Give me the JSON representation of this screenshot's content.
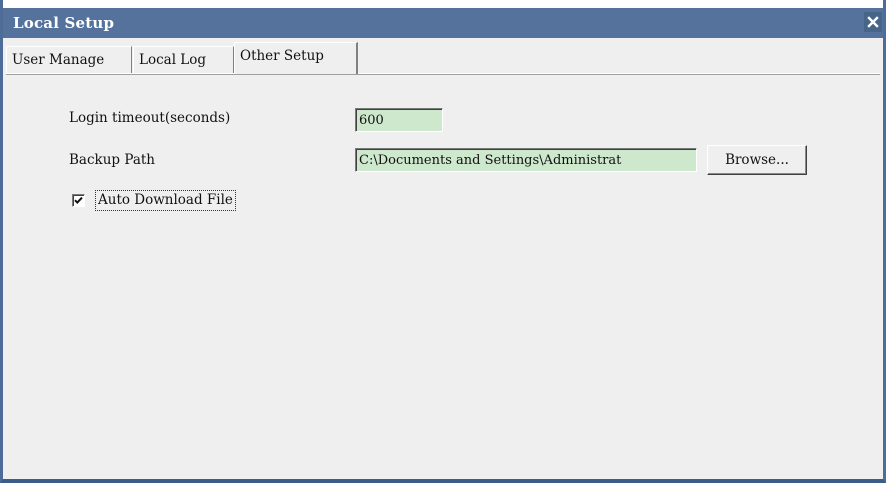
{
  "window": {
    "title": "Local Setup"
  },
  "tabs": [
    {
      "label": "User Manage",
      "active": false
    },
    {
      "label": "Local Log",
      "active": false
    },
    {
      "label": "Other Setup",
      "active": true
    }
  ],
  "other_setup": {
    "login_timeout_label": "Login timeout(seconds)",
    "login_timeout_value": "600",
    "backup_path_label": "Backup Path",
    "backup_path_value": "C:\\Documents and Settings\\Administrat",
    "browse_label": "Browse...",
    "auto_download_label": "Auto Download File",
    "auto_download_checked": true
  },
  "colors": {
    "titlebar": "#54729b",
    "panel": "#efefef",
    "field_bg": "#cde8cd"
  },
  "icons": {
    "close": "close-icon",
    "check": "checkmark-icon"
  }
}
